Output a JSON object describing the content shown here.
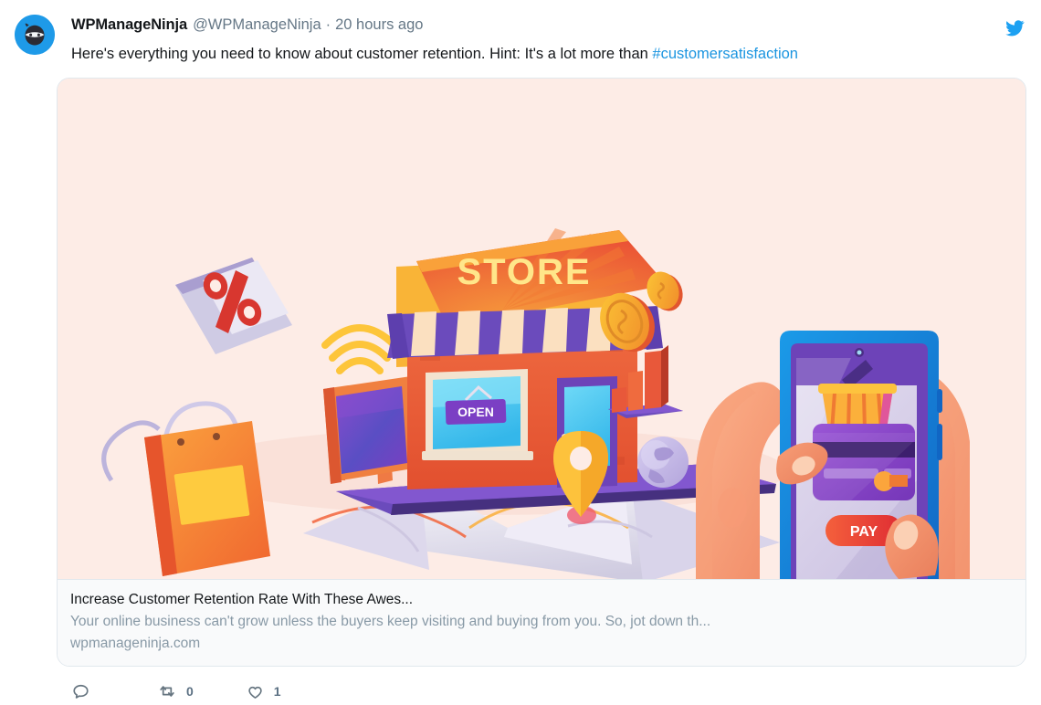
{
  "tweet": {
    "display_name": "WPManageNinja",
    "handle": "@WPManageNinja",
    "separator": "·",
    "timestamp": "20 hours ago",
    "text_before_link": "Here's everything you need to know about customer retention. Hint: It's a lot more than ",
    "hashtag": "#customersatisfaction",
    "platform_icon": "twitter-bird-icon",
    "avatar_icon": "ninja-avatar"
  },
  "card": {
    "title": "Increase Customer Retention Rate With These Awes...",
    "description": "Your online business can't grow unless the buyers keep visiting and buying from you. So, jot down th...",
    "domain": "wpmanageninja.com",
    "image_alt": "ecommerce-store-mobile-payment-illustration",
    "image_labels": {
      "store_sign": "STORE",
      "open_sign": "OPEN",
      "pay_button": "PAY"
    }
  },
  "actions": [
    {
      "name": "reply",
      "icon": "reply-icon",
      "count": ""
    },
    {
      "name": "retweet",
      "icon": "retweet-icon",
      "count": "0"
    },
    {
      "name": "like",
      "icon": "heart-icon",
      "count": "1"
    }
  ],
  "colors": {
    "accent": "#1b95e0",
    "text": "#14171a",
    "muted": "#657786",
    "card_border": "#e1e8ed",
    "card_body_bg": "#f9fafb",
    "media_bg": "#fdece6",
    "action_icon": "#667580",
    "avatar_bg": "#1e9ae8"
  }
}
